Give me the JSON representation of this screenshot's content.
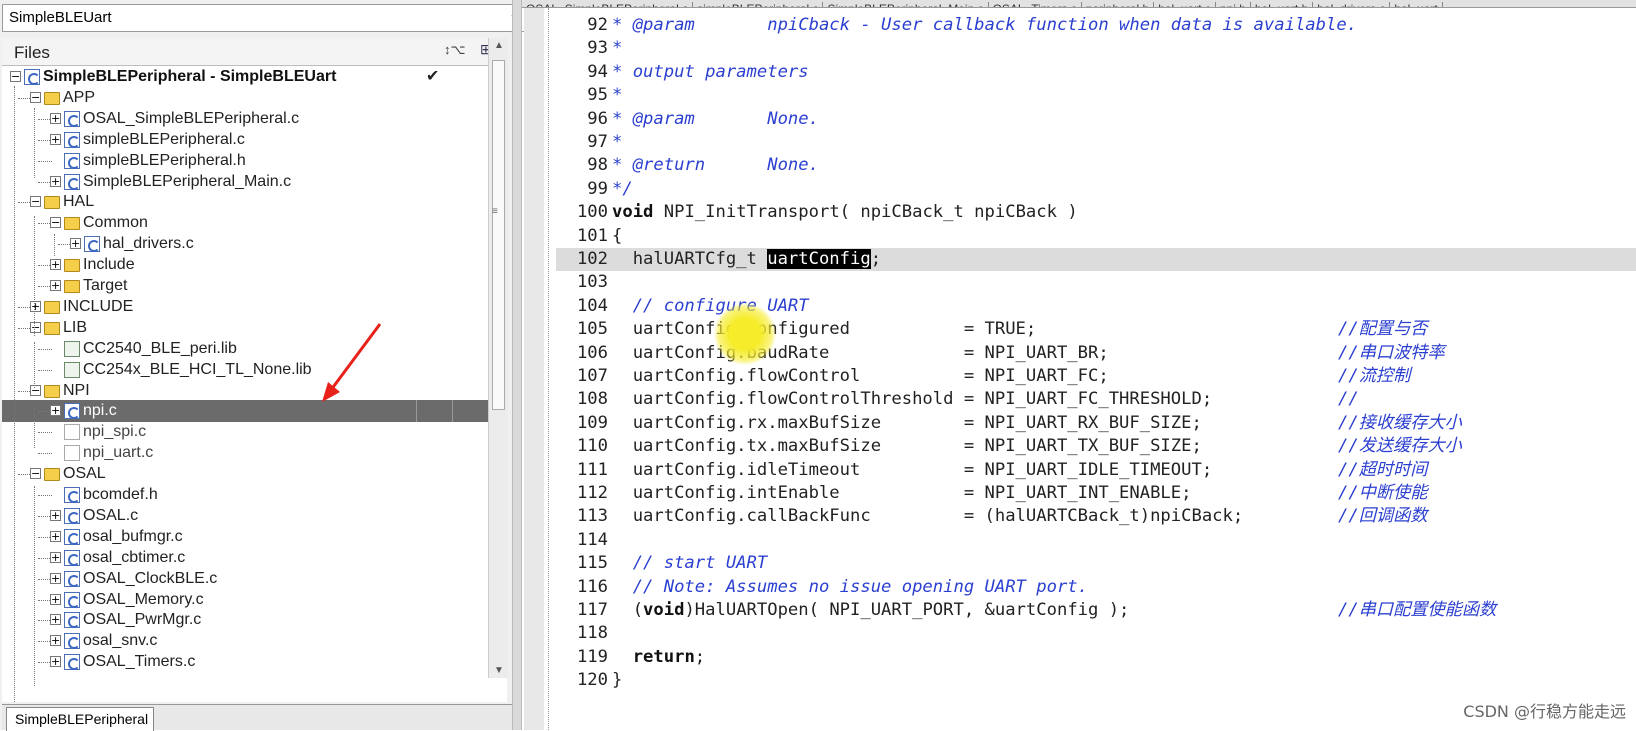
{
  "workspace": {
    "combo_value": "SimpleBLEUart",
    "files_label": "Files",
    "bottom_tab": "SimpleBLEPeripheral"
  },
  "tree": [
    {
      "label": "SimpleBLEPeripheral - SimpleBLEUart",
      "lvl": 0,
      "kind": "project",
      "pm": "−",
      "bold": true,
      "check": "✔"
    },
    {
      "label": "APP",
      "lvl": 1,
      "kind": "folder",
      "pm": "−"
    },
    {
      "label": "OSAL_SimpleBLEPeripheral.c",
      "lvl": 2,
      "kind": "c",
      "pm": "+"
    },
    {
      "label": "simpleBLEPeripheral.c",
      "lvl": 2,
      "kind": "c",
      "pm": "+"
    },
    {
      "label": "simpleBLEPeripheral.h",
      "lvl": 2,
      "kind": "h",
      "pm": ""
    },
    {
      "label": "SimpleBLEPeripheral_Main.c",
      "lvl": 2,
      "kind": "c",
      "pm": "+"
    },
    {
      "label": "HAL",
      "lvl": 1,
      "kind": "folder",
      "pm": "−"
    },
    {
      "label": "Common",
      "lvl": 2,
      "kind": "folder",
      "pm": "−"
    },
    {
      "label": "hal_drivers.c",
      "lvl": 3,
      "kind": "c",
      "pm": "+"
    },
    {
      "label": "Include",
      "lvl": 2,
      "kind": "folder",
      "pm": "+"
    },
    {
      "label": "Target",
      "lvl": 2,
      "kind": "folder",
      "pm": "+"
    },
    {
      "label": "INCLUDE",
      "lvl": 1,
      "kind": "folder",
      "pm": "+"
    },
    {
      "label": "LIB",
      "lvl": 1,
      "kind": "folder",
      "pm": "−"
    },
    {
      "label": "CC2540_BLE_peri.lib",
      "lvl": 2,
      "kind": "lib",
      "pm": ""
    },
    {
      "label": "CC254x_BLE_HCI_TL_None.lib",
      "lvl": 2,
      "kind": "lib",
      "pm": ""
    },
    {
      "label": "NPI",
      "lvl": 1,
      "kind": "folder",
      "pm": "−"
    },
    {
      "label": "npi.c",
      "lvl": 2,
      "kind": "c",
      "pm": "+",
      "selected": true
    },
    {
      "label": "npi_spi.c",
      "lvl": 2,
      "kind": "x",
      "pm": ""
    },
    {
      "label": "npi_uart.c",
      "lvl": 2,
      "kind": "x",
      "pm": ""
    },
    {
      "label": "OSAL",
      "lvl": 1,
      "kind": "folder",
      "pm": "−"
    },
    {
      "label": "bcomdef.h",
      "lvl": 2,
      "kind": "h",
      "pm": ""
    },
    {
      "label": "OSAL.c",
      "lvl": 2,
      "kind": "c",
      "pm": "+"
    },
    {
      "label": "osal_bufmgr.c",
      "lvl": 2,
      "kind": "c",
      "pm": "+"
    },
    {
      "label": "osal_cbtimer.c",
      "lvl": 2,
      "kind": "c",
      "pm": "+"
    },
    {
      "label": "OSAL_ClockBLE.c",
      "lvl": 2,
      "kind": "c",
      "pm": "+"
    },
    {
      "label": "OSAL_Memory.c",
      "lvl": 2,
      "kind": "c",
      "pm": "+"
    },
    {
      "label": "OSAL_PwrMgr.c",
      "lvl": 2,
      "kind": "c",
      "pm": "+"
    },
    {
      "label": "osal_snv.c",
      "lvl": 2,
      "kind": "c",
      "pm": "+"
    },
    {
      "label": "OSAL_Timers.c",
      "lvl": 2,
      "kind": "c",
      "pm": "+"
    }
  ],
  "editor_tabs": [
    "OSAL_SimpleBLEPeripheral.c",
    "simpleBLEPeripheral.c",
    "SimpleBLEPeripheral_Main.c",
    "OSAL_Timers.c",
    "peripheral.h",
    "hal_uart.c",
    "npi.h",
    "hal_uart.h",
    "hal_drivers.c",
    "hal_uart"
  ],
  "code": [
    {
      "n": "92",
      "t": "* @param       npiCback - User callback function when data is available.",
      "c": "",
      "style": "comment"
    },
    {
      "n": "93",
      "t": "*",
      "c": "",
      "style": "comment"
    },
    {
      "n": "94",
      "t": "* output parameters",
      "c": "",
      "style": "comment"
    },
    {
      "n": "95",
      "t": "*",
      "c": "",
      "style": "comment"
    },
    {
      "n": "96",
      "t": "* @param       None.",
      "c": "",
      "style": "comment"
    },
    {
      "n": "97",
      "t": "*",
      "c": "",
      "style": "comment"
    },
    {
      "n": "98",
      "t": "* @return      None.",
      "c": "",
      "style": "comment"
    },
    {
      "n": "99",
      "t": "*/",
      "c": "",
      "style": "comment"
    },
    {
      "n": "100",
      "t": "void NPI_InitTransport( npiCBack_t npiCBack )",
      "c": "",
      "style": "void"
    },
    {
      "n": "101",
      "t": "{",
      "c": "",
      "style": ""
    },
    {
      "n": "102",
      "t": "  halUARTCfg_t uartConfig;",
      "c": "",
      "style": "hl",
      "hl": "uartConfig",
      "current": true
    },
    {
      "n": "103",
      "t": "",
      "c": "",
      "style": ""
    },
    {
      "n": "104",
      "t": "  // configure UART",
      "c": "",
      "style": "comment"
    },
    {
      "n": "105",
      "t": "  uartConfig.configured           = TRUE;",
      "c": "//配置与否",
      "style": ""
    },
    {
      "n": "106",
      "t": "  uartConfig.baudRate             = NPI_UART_BR;",
      "c": "//串口波特率",
      "style": ""
    },
    {
      "n": "107",
      "t": "  uartConfig.flowControl          = NPI_UART_FC;",
      "c": "//流控制",
      "style": ""
    },
    {
      "n": "108",
      "t": "  uartConfig.flowControlThreshold = NPI_UART_FC_THRESHOLD;",
      "c": "//",
      "style": ""
    },
    {
      "n": "109",
      "t": "  uartConfig.rx.maxBufSize        = NPI_UART_RX_BUF_SIZE;",
      "c": "//接收缓存大小",
      "style": ""
    },
    {
      "n": "110",
      "t": "  uartConfig.tx.maxBufSize        = NPI_UART_TX_BUF_SIZE;",
      "c": "//发送缓存大小",
      "style": ""
    },
    {
      "n": "111",
      "t": "  uartConfig.idleTimeout          = NPI_UART_IDLE_TIMEOUT;",
      "c": "//超时时间",
      "style": ""
    },
    {
      "n": "112",
      "t": "  uartConfig.intEnable            = NPI_UART_INT_ENABLE;",
      "c": "//中断使能",
      "style": ""
    },
    {
      "n": "113",
      "t": "  uartConfig.callBackFunc         = (halUARTCBack_t)npiCBack;",
      "c": "//回调函数",
      "style": ""
    },
    {
      "n": "114",
      "t": "",
      "c": "",
      "style": ""
    },
    {
      "n": "115",
      "t": "  // start UART",
      "c": "",
      "style": "comment"
    },
    {
      "n": "116",
      "t": "  // Note: Assumes no issue opening UART port.",
      "c": "",
      "style": "comment"
    },
    {
      "n": "117",
      "t": "  (void)HalUARTOpen( NPI_UART_PORT, &uartConfig );",
      "c": "//串口配置使能函数",
      "style": "voidcast"
    },
    {
      "n": "118",
      "t": "",
      "c": "",
      "style": ""
    },
    {
      "n": "119",
      "t": "  return;",
      "c": "",
      "style": "return"
    },
    {
      "n": "120",
      "t": "}",
      "c": "",
      "style": ""
    }
  ],
  "watermark": "CSDN @行稳方能走远",
  "colors": {
    "comment": "#2b3fd0",
    "selection": "#6b6b6b",
    "folder": "#f5cf4a"
  }
}
